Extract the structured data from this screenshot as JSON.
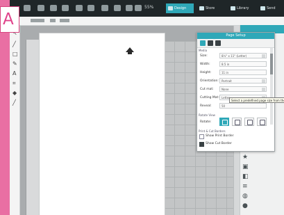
{
  "label": "A",
  "toolbar": {
    "zoom_value": "55%",
    "tabs": [
      {
        "label": "Design"
      },
      {
        "label": "Store"
      },
      {
        "label": "Library"
      },
      {
        "label": "Send"
      }
    ]
  },
  "page_setup": {
    "title": "Page Setup",
    "section_media": "Media",
    "rows": [
      {
        "label": "Size:",
        "value": "8½\" x 11\" (Letter)"
      },
      {
        "label": "Width:",
        "value": "8.5 in"
      },
      {
        "label": "Height:",
        "value": "11 in"
      },
      {
        "label": "Orientation:",
        "value": "Portrait"
      },
      {
        "label": "Cut mat:",
        "value": "None"
      },
      {
        "label": "Cutting Mat:",
        "value": "Letter"
      },
      {
        "label": "Reveal:",
        "value": "50"
      }
    ],
    "section_rotate": "Rotate View",
    "rotate_label": "Rotate:",
    "section_print": "Print & Cut Borders",
    "check1": "Show Print Border",
    "check2": "Show Cut Border",
    "tooltip": "Select a predefined page size from the list"
  },
  "colors": {
    "accent": "#2fa8b8",
    "frame": "#e96fa3"
  }
}
